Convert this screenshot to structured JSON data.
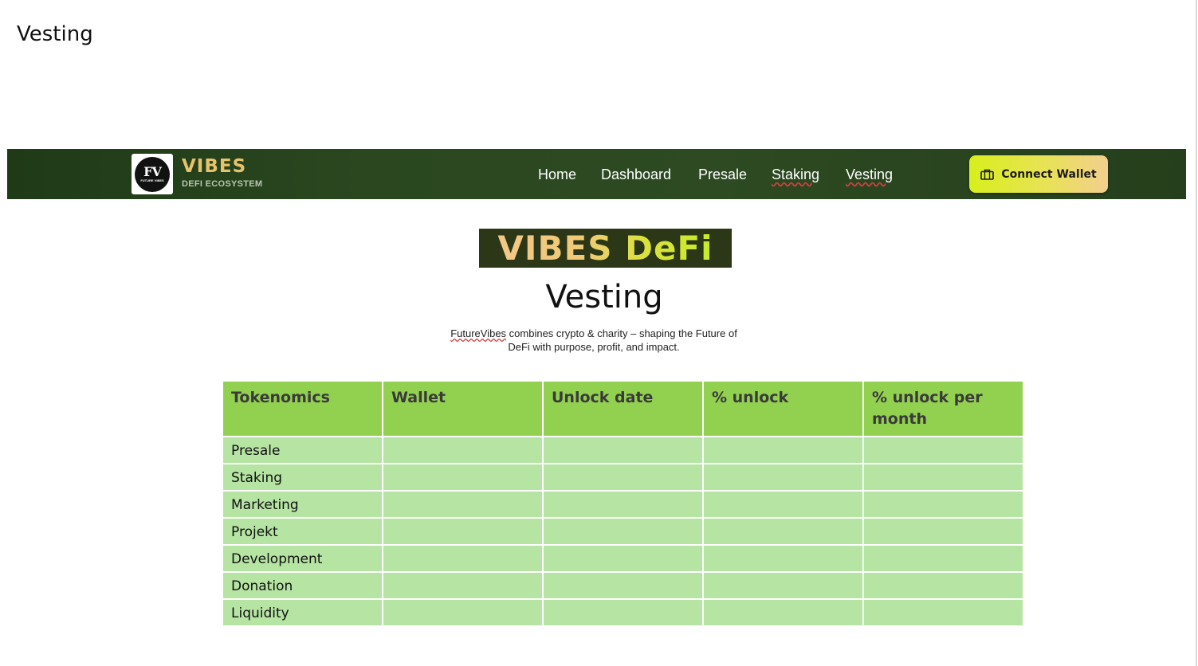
{
  "document": {
    "heading": "Vesting"
  },
  "navbar": {
    "logo": {
      "mark": "FV",
      "mark_sub": "FUTURE VIBES"
    },
    "brand_title": "VIBES",
    "brand_subtitle": "DEFI ECOSYSTEM",
    "links": [
      {
        "label": "Home"
      },
      {
        "label": "Dashboard"
      },
      {
        "label": "Presale"
      },
      {
        "label": "Staking"
      },
      {
        "label": "Vesting"
      }
    ],
    "connect_button": {
      "label": "Connect Wallet",
      "icon": "wallet-icon"
    }
  },
  "hero": {
    "banner_text": "VIBES DeFi",
    "title": "Vesting",
    "tagline_brand": "FutureVibes",
    "tagline_rest": " combines crypto & charity – shaping the Future of DeFi with purpose, profit, and impact."
  },
  "table": {
    "headers": [
      "Tokenomics",
      "Wallet",
      "Unlock date",
      "% unlock",
      "% unlock per month"
    ],
    "rows": [
      [
        "Presale",
        "",
        "",
        "",
        ""
      ],
      [
        "Staking",
        "",
        "",
        "",
        ""
      ],
      [
        "Marketing",
        "",
        "",
        "",
        ""
      ],
      [
        "Projekt",
        "",
        "",
        "",
        ""
      ],
      [
        "Development",
        "",
        "",
        "",
        ""
      ],
      [
        "Donation",
        "",
        "",
        "",
        ""
      ],
      [
        "Liquidity",
        "",
        "",
        "",
        ""
      ]
    ]
  },
  "colors": {
    "navbar_bg": "#2a4720",
    "accent_gold": "#e6c26a",
    "button_gradient_start": "#d8ef1c",
    "button_gradient_end": "#f2cf8e",
    "table_header": "#92d050",
    "table_cell": "#b5e4a3"
  }
}
